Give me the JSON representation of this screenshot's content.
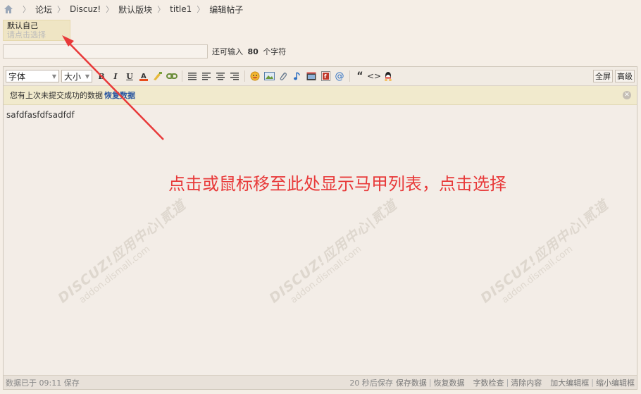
{
  "breadcrumb": {
    "items": [
      "论坛",
      "Discuz!",
      "默认版块",
      "title1",
      "编辑帖子"
    ]
  },
  "puppet": {
    "name": "默认自己",
    "hint": "请点击选择"
  },
  "title": {
    "value": "",
    "counter_prefix": "还可输入",
    "counter_value": "80",
    "counter_suffix": "个字符"
  },
  "toolbar": {
    "font_label": "字体",
    "size_label": "大小",
    "fullscreen_label": "全屏",
    "advanced_label": "高级"
  },
  "notice": {
    "text": "您有上次未提交成功的数据",
    "restore_link": "恢复数据"
  },
  "content": {
    "text": "safdfasfdfsadfdf"
  },
  "callout": {
    "text": "点击或鼠标移至此处显示马甲列表，点击选择",
    "color": "#e83a3a"
  },
  "watermark": {
    "line1": "DISCUZ!应用中心|贰道",
    "line2": "addon.dismall.com"
  },
  "statusbar": {
    "saved": "数据已于 09:11 保存",
    "autosave": "20 秒后保存",
    "save_data": "保存数据",
    "restore_data": "恢复数据",
    "word_check": "字数检查",
    "clear_content": "清除内容",
    "enlarge": "加大编辑框",
    "shrink": "缩小编辑框"
  }
}
